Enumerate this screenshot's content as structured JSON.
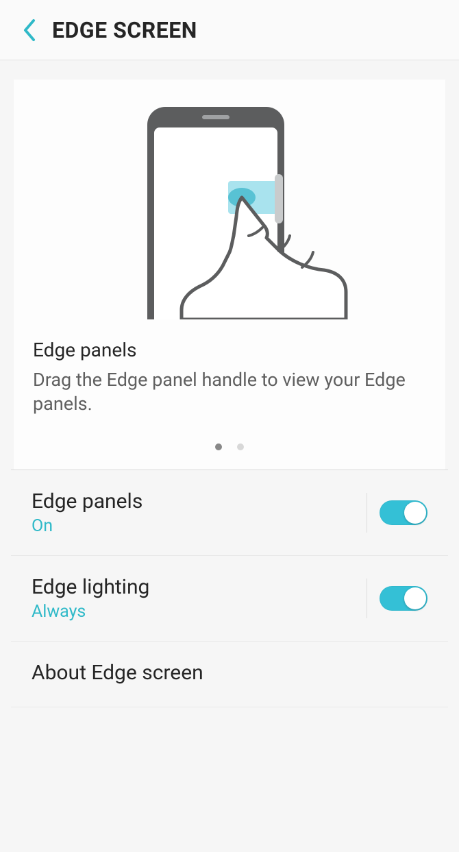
{
  "header": {
    "title": "EDGE SCREEN"
  },
  "card": {
    "title": "Edge panels",
    "description": "Drag the Edge panel handle to view your Edge panels.",
    "page_count": 2,
    "active_page": 0
  },
  "settings": {
    "edge_panels": {
      "title": "Edge panels",
      "status": "On",
      "enabled": true
    },
    "edge_lighting": {
      "title": "Edge lighting",
      "status": "Always",
      "enabled": true
    },
    "about": {
      "title": "About Edge screen"
    }
  }
}
